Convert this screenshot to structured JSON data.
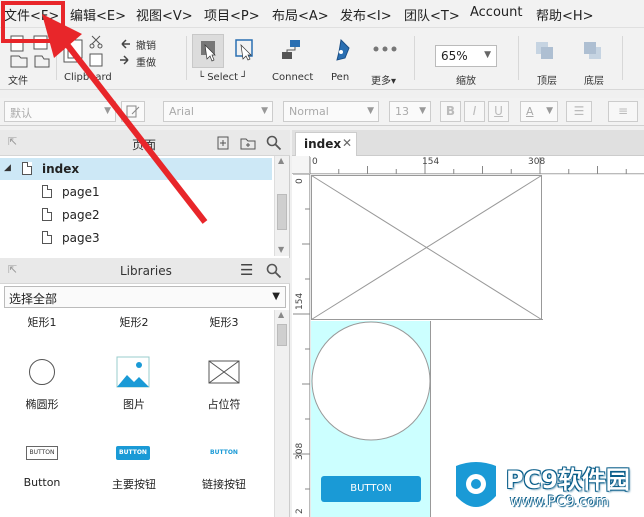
{
  "menubar": {
    "items": [
      "文件<F>",
      "编辑<E>",
      "视图<V>",
      "项目<P>",
      "布局<A>",
      "发布<I>",
      "团队<T>",
      "Account",
      "帮助<H>"
    ]
  },
  "toolbar": {
    "file_label": "文件",
    "clipboard_label": "Clipboard",
    "cut_label": "撤销",
    "redo_label": "重做",
    "select_label": "Select",
    "connect_label": "Connect",
    "pen_label": "Pen",
    "more_label": "更多",
    "zoom_value": "65%",
    "zoom_label": "缩放",
    "top_label": "顶层",
    "bottom_label": "底层"
  },
  "formatbar": {
    "style_value": "默认",
    "font_value": "Arial",
    "weight_value": "Normal",
    "size_value": "13"
  },
  "pages_panel": {
    "title": "页面",
    "root": "index",
    "pages": [
      "page1",
      "page2",
      "page3"
    ]
  },
  "libraries_panel": {
    "title": "Libraries",
    "filter_value": "选择全部",
    "top_row": [
      "矩形1",
      "矩形2",
      "矩形3"
    ],
    "items": [
      {
        "label": "椭圆形",
        "icon": "ellipse-icon"
      },
      {
        "label": "图片",
        "icon": "image-icon"
      },
      {
        "label": "占位符",
        "icon": "placeholder-icon"
      },
      {
        "label": "Button",
        "icon": "button-icon",
        "preview": "BUTTON"
      },
      {
        "label": "主要按钮",
        "icon": "primary-button-icon",
        "preview": "BUTTON"
      },
      {
        "label": "链接按钮",
        "icon": "link-button-icon",
        "preview": "BUTTON"
      }
    ]
  },
  "canvas": {
    "tab_label": "index",
    "ruler_h": [
      "0",
      "154",
      "308"
    ],
    "ruler_v": [
      "0",
      "154",
      "308",
      "2"
    ],
    "button_text": "BUTTON"
  },
  "watermark": {
    "brand": "PC9软件园",
    "url": "www.PC9.com"
  },
  "colors": {
    "highlight_red": "#e8262a",
    "selection_cyan": "#ccffff",
    "primary_button": "#1a9ad6",
    "tree_selected": "#cde8f6"
  }
}
